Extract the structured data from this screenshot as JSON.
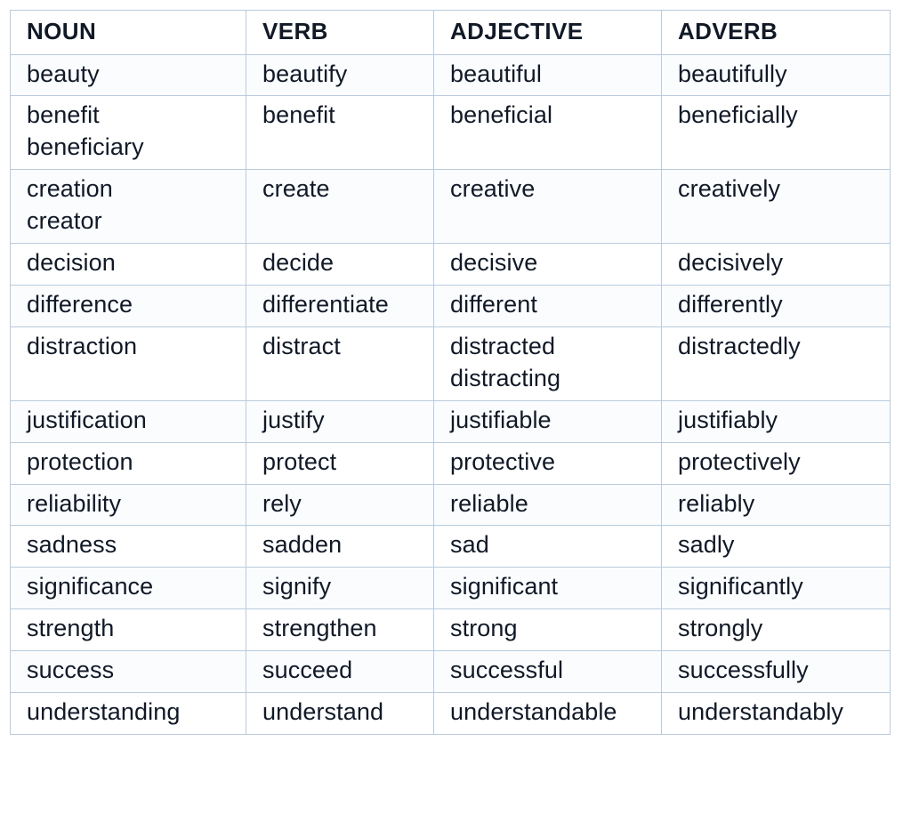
{
  "table": {
    "name": "word-forms-table",
    "columns": [
      {
        "key": "noun",
        "label": "NOUN"
      },
      {
        "key": "verb",
        "label": "VERB"
      },
      {
        "key": "adjective",
        "label": "ADJECTIVE"
      },
      {
        "key": "adverb",
        "label": "ADVERB"
      }
    ],
    "rows": [
      {
        "noun": [
          "beauty"
        ],
        "verb": [
          "beautify"
        ],
        "adjective": [
          "beautiful"
        ],
        "adverb": [
          "beautifully"
        ]
      },
      {
        "noun": [
          "benefit",
          "beneficiary"
        ],
        "verb": [
          "benefit"
        ],
        "adjective": [
          "beneficial"
        ],
        "adverb": [
          "beneficially"
        ]
      },
      {
        "noun": [
          "creation",
          "creator"
        ],
        "verb": [
          "create"
        ],
        "adjective": [
          "creative"
        ],
        "adverb": [
          "creatively"
        ]
      },
      {
        "noun": [
          "decision"
        ],
        "verb": [
          "decide"
        ],
        "adjective": [
          "decisive"
        ],
        "adverb": [
          "decisively"
        ]
      },
      {
        "noun": [
          "difference"
        ],
        "verb": [
          "differentiate"
        ],
        "adjective": [
          "different"
        ],
        "adverb": [
          "differently"
        ]
      },
      {
        "noun": [
          "distraction"
        ],
        "verb": [
          "distract"
        ],
        "adjective": [
          "distracted",
          "distracting"
        ],
        "adverb": [
          "distractedly"
        ]
      },
      {
        "noun": [
          "justification"
        ],
        "verb": [
          "justify"
        ],
        "adjective": [
          "justifiable"
        ],
        "adverb": [
          "justifiably"
        ]
      },
      {
        "noun": [
          "protection"
        ],
        "verb": [
          "protect"
        ],
        "adjective": [
          "protective"
        ],
        "adverb": [
          "protectively"
        ]
      },
      {
        "noun": [
          "reliability"
        ],
        "verb": [
          "rely"
        ],
        "adjective": [
          "reliable"
        ],
        "adverb": [
          "reliably"
        ]
      },
      {
        "noun": [
          "sadness"
        ],
        "verb": [
          "sadden"
        ],
        "adjective": [
          "sad"
        ],
        "adverb": [
          "sadly"
        ]
      },
      {
        "noun": [
          "significance"
        ],
        "verb": [
          "signify"
        ],
        "adjective": [
          "significant"
        ],
        "adverb": [
          "significantly"
        ]
      },
      {
        "noun": [
          "strength"
        ],
        "verb": [
          "strengthen"
        ],
        "adjective": [
          "strong"
        ],
        "adverb": [
          "strongly"
        ]
      },
      {
        "noun": [
          "success"
        ],
        "verb": [
          "succeed"
        ],
        "adjective": [
          "successful"
        ],
        "adverb": [
          "successfully"
        ]
      },
      {
        "noun": [
          "understanding"
        ],
        "verb": [
          "understand"
        ],
        "adjective": [
          "understandable"
        ],
        "adverb": [
          "understandably"
        ]
      }
    ]
  },
  "style": {
    "border_color": "#b9cbdd",
    "text_color": "#111927",
    "background_color": "#ffffff",
    "tint_color": "#fbfcfe"
  }
}
